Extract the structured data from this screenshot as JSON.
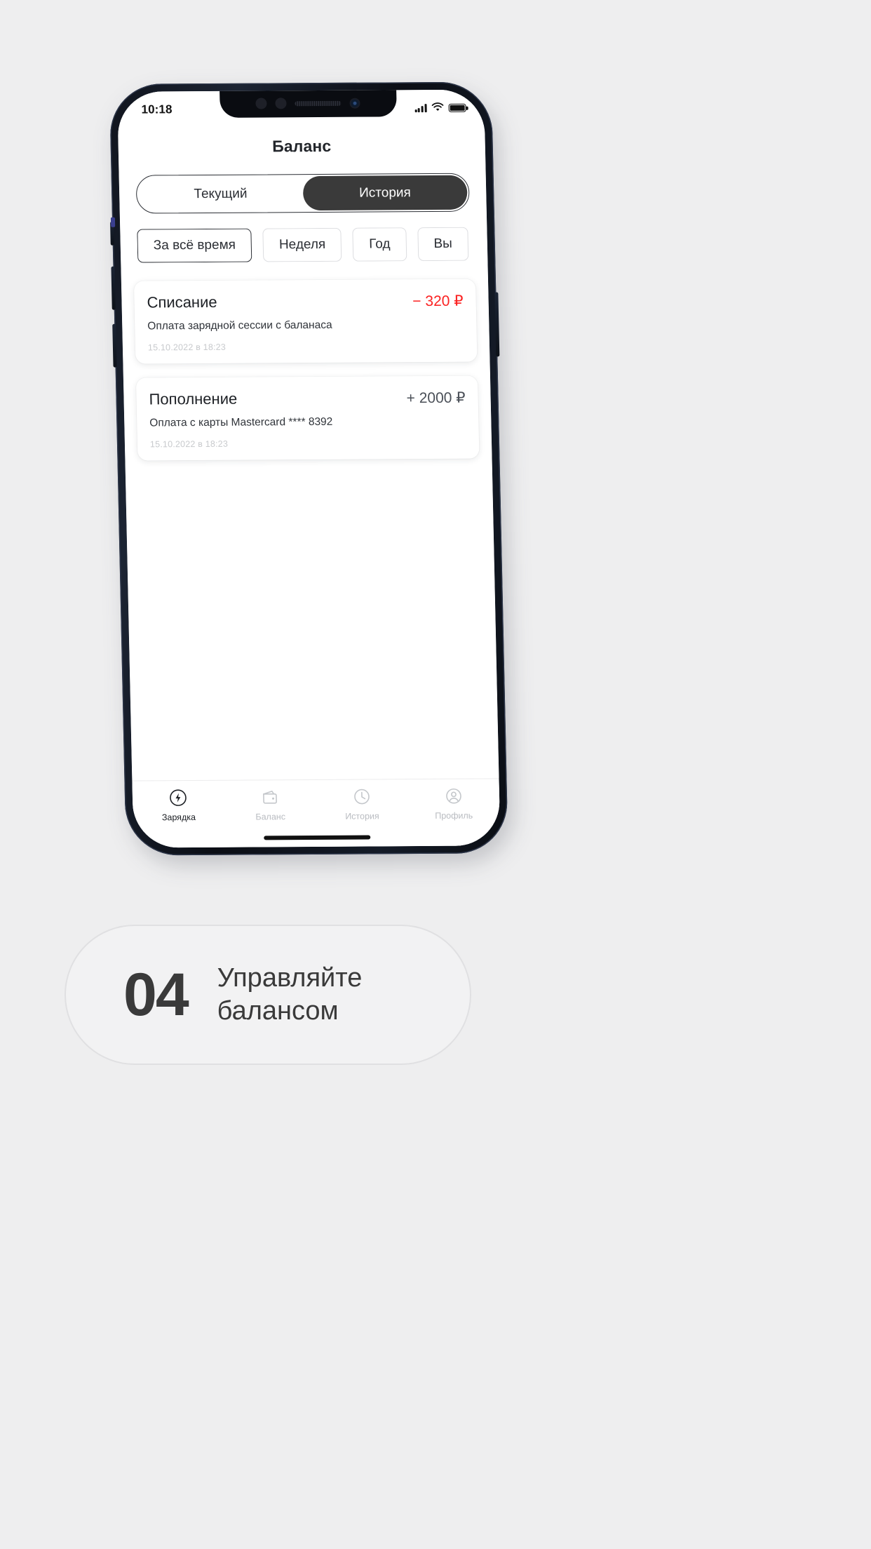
{
  "status_bar": {
    "time": "10:18",
    "signal_icon": "cellular-signal-icon",
    "wifi_icon": "wifi-icon",
    "battery_icon": "battery-icon"
  },
  "header": {
    "title": "Баланс"
  },
  "segmented_control": {
    "items": [
      {
        "label": "Текущий",
        "active": false
      },
      {
        "label": "История",
        "active": true
      }
    ]
  },
  "filters": {
    "chips": [
      {
        "label": "За всё время",
        "active": true
      },
      {
        "label": "Неделя",
        "active": false
      },
      {
        "label": "Год",
        "active": false
      },
      {
        "label": "Вы",
        "active": false
      }
    ]
  },
  "transactions": [
    {
      "title": "Списание",
      "amount": "− 320 ₽",
      "sign": "neg",
      "description": "Оплата зарядной сессии с баланаса",
      "date": "15.10.2022 в 18:23"
    },
    {
      "title": "Пополнение",
      "amount": "+ 2000 ₽",
      "sign": "pos",
      "description": "Оплата с карты Mastercard **** 8392",
      "date": "15.10.2022 в 18:23"
    }
  ],
  "tabbar": {
    "items": [
      {
        "label": "Зарядка",
        "icon": "charging-bolt-icon",
        "active": true
      },
      {
        "label": "Баланс",
        "icon": "wallet-icon",
        "active": false
      },
      {
        "label": "История",
        "icon": "clock-history-icon",
        "active": false
      },
      {
        "label": "Профиль",
        "icon": "person-profile-icon",
        "active": false
      }
    ]
  },
  "caption": {
    "number": "04",
    "text": "Управляйте балансом"
  },
  "colors": {
    "page_background": "#eeeeef",
    "accent_dark": "#3a3a3a",
    "negative_amount": "#fb2222",
    "muted_text": "#b9bcc1"
  }
}
